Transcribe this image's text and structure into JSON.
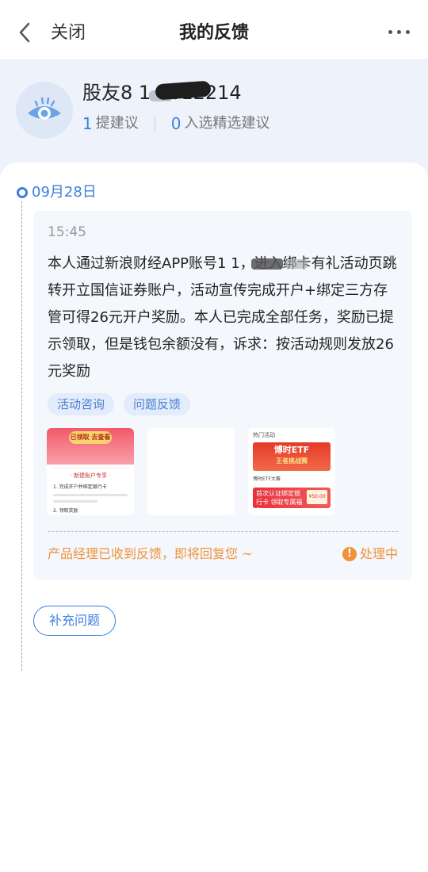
{
  "nav": {
    "close_label": "关闭",
    "title": "我的反馈"
  },
  "profile": {
    "username": "股友8  1  0012214",
    "suggest_count": "1",
    "suggest_label": "提建议",
    "selected_count": "0",
    "selected_label": "入选精选建议"
  },
  "timeline": {
    "date": "09月28日"
  },
  "feedback": {
    "time": "15:45",
    "content": "本人通过新浪财经APP账号1          1，进入绑卡有礼活动页跳转开立国信证券账户，活动宣传完成开户+绑定三方存管可得26元开户奖励。本人已完成全部任务，奖励已提示领取，但是钱包余额没有，诉求：按活动规则发放26元奖励",
    "tags": [
      "活动咨询",
      "问题反馈"
    ],
    "thumb1": {
      "button": "已领取 去查看",
      "title": "· 新建账户专享 ·",
      "step1": "1. 完成开户并绑定银行卡",
      "step2": "2. 领取奖励"
    },
    "thumb3": {
      "header": "热门活动",
      "banner1_title": "博时ETF",
      "banner1_sub": "王者挑战赛",
      "middle": "博时ETF大赛",
      "banner2_text": "首次认证绑定银行卡 领取专属福利",
      "banner2_badge": "¥50.00"
    },
    "reply_text": "产品经理已收到反馈，即将回复您 ~",
    "status": "处理中"
  },
  "actions": {
    "supplement_label": "补充问题"
  },
  "colors": {
    "accent": "#3c7fe0",
    "warning": "#f0923a"
  }
}
